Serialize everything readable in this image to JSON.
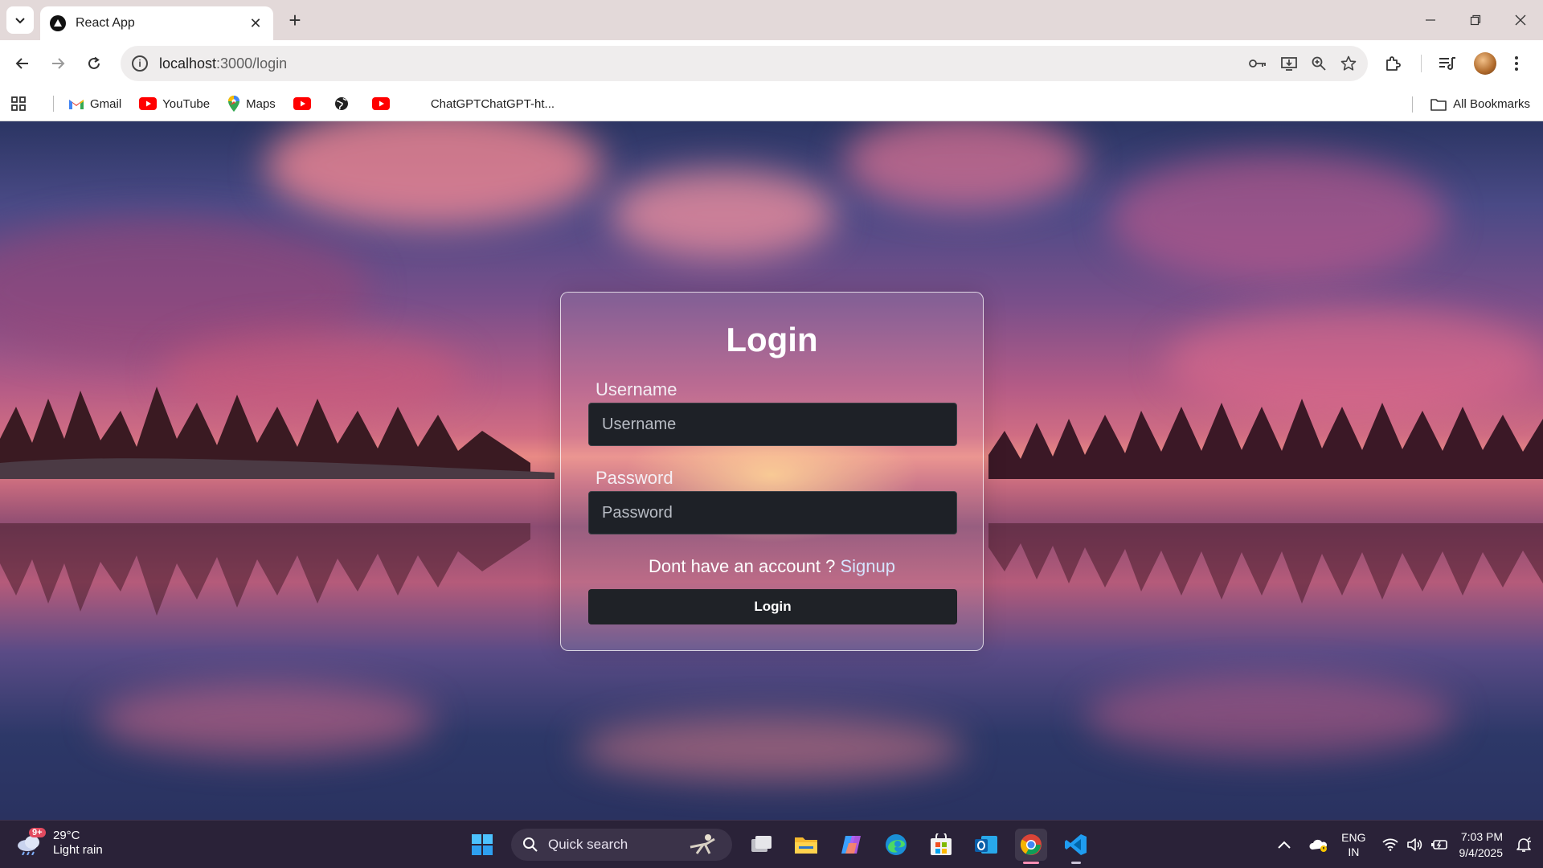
{
  "browser": {
    "tab_title": "React App",
    "url_host": "localhost",
    "url_path": ":3000/login",
    "bookmarks": [
      {
        "label": "Gmail",
        "icon": "gmail-icon"
      },
      {
        "label": "YouTube",
        "icon": "youtube-icon"
      },
      {
        "label": "Maps",
        "icon": "maps-icon"
      },
      {
        "label": "",
        "icon": "youtube-icon"
      },
      {
        "label": "",
        "icon": "globe-icon"
      },
      {
        "label": "",
        "icon": "youtube-icon"
      },
      {
        "label": "ChatGPTChatGPT-ht...",
        "icon": ""
      }
    ],
    "all_bookmarks": "All Bookmarks"
  },
  "login": {
    "title": "Login",
    "username_label": "Username",
    "username_placeholder": "Username",
    "password_label": "Password",
    "password_placeholder": "Password",
    "signup_prompt": "Dont have an account ?",
    "signup_link": "Signup",
    "submit_label": "Login"
  },
  "taskbar": {
    "weather_badge": "9+",
    "weather_temp": "29°C",
    "weather_desc": "Light rain",
    "search_placeholder": "Quick search",
    "lang_line1": "ENG",
    "lang_line2": "IN",
    "time": "7:03 PM",
    "date": "9/4/2025"
  },
  "colors": {
    "card_border": "#ffffff",
    "input_bg": "#1e2127",
    "taskbar_bg": "#2a2238"
  }
}
